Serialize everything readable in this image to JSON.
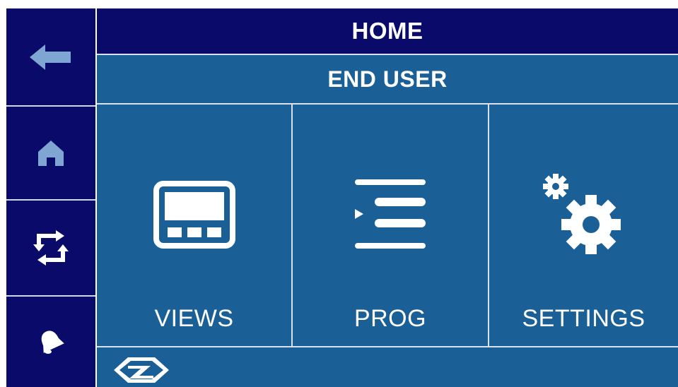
{
  "header": {
    "title": "HOME",
    "subtitle": "END USER"
  },
  "sidebar": {
    "items": [
      {
        "icon": "back-arrow-icon"
      },
      {
        "icon": "home-icon"
      },
      {
        "icon": "refresh-cycle-icon"
      },
      {
        "icon": "bell-icon"
      }
    ]
  },
  "menu": {
    "tiles": [
      {
        "label": "VIEWS",
        "icon": "display-panel-icon"
      },
      {
        "label": "PROG",
        "icon": "program-list-icon"
      },
      {
        "label": "SETTINGS",
        "icon": "gears-icon"
      }
    ]
  },
  "footer": {
    "icon": "brand-logo-icon"
  },
  "colors": {
    "navy": "#0a0a6a",
    "panel_blue": "#1b5f97",
    "icon_light_blue": "#7fa6d3",
    "white": "#ffffff"
  }
}
